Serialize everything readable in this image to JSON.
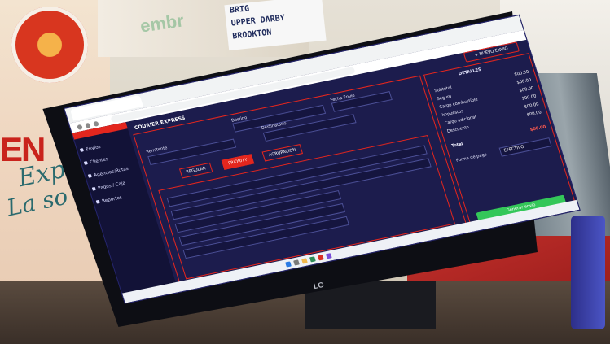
{
  "colors": {
    "sidebar_bg": "#121237",
    "panel_bg": "#1c1c4d",
    "accent": "#e3261e",
    "success": "#34c759",
    "monitor_bezel": "#0d0e14"
  },
  "background": {
    "poster_big": "EN",
    "poster_script_1": "Expr",
    "poster_script_2": "La so",
    "top_poster_text": "embr",
    "note_lines": [
      "BRIG",
      "UPPER DARBY",
      "BROOKTON"
    ],
    "monitor_brand": "LG"
  },
  "app": {
    "sidebar_items": [
      {
        "label": "Envíos",
        "icon": "box-icon"
      },
      {
        "label": "Clientes",
        "icon": "user-icon"
      },
      {
        "label": "Agencias/Rutas",
        "icon": "route-icon"
      },
      {
        "label": "Pagos / Caja",
        "icon": "cash-icon"
      },
      {
        "label": "Reportes",
        "icon": "report-icon"
      }
    ],
    "title": "COURIER EXPRESS",
    "top_button": "+ NUEVO ENVIO",
    "header_labels": {
      "destino": "Destino",
      "fecha": "Fecha Envío",
      "remitente": "Remitente",
      "destinatario": "Destinatario"
    },
    "tabs": [
      "REGULAR",
      "PRIORITY",
      "AGRUPACION"
    ],
    "summary": {
      "title": "DETALLES",
      "rows": [
        {
          "label": "Subtotal",
          "value": "$00.00"
        },
        {
          "label": "Seguro",
          "value": "$00.00"
        },
        {
          "label": "Cargo combustible",
          "value": "$00.00"
        },
        {
          "label": "Impuestos",
          "value": "$00.00"
        },
        {
          "label": "Cargo adicional",
          "value": "$00.00"
        },
        {
          "label": "Descuento",
          "value": "$00.00"
        }
      ],
      "total_label": "Total",
      "total_value": "$00.00",
      "payment_label": "Forma de pago",
      "payment_value": "EFECTIVO",
      "green_button": "Generar envío"
    }
  }
}
